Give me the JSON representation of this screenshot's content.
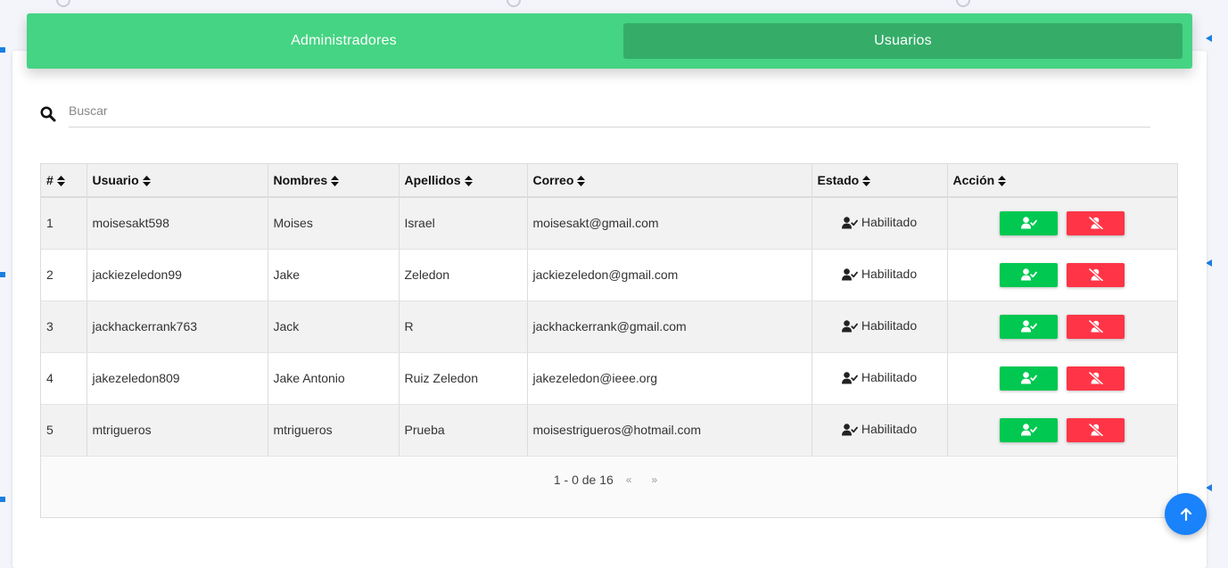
{
  "tabs": [
    {
      "label": "Administradores",
      "active": false
    },
    {
      "label": "Usuarios",
      "active": true
    }
  ],
  "search": {
    "placeholder": "Buscar"
  },
  "table": {
    "headers": [
      "#",
      "Usuario",
      "Nombres",
      "Apellidos",
      "Correo",
      "Estado",
      "Acción"
    ],
    "rows": [
      {
        "num": "1",
        "usuario": "moisesakt598",
        "nombres": "Moises",
        "apellidos": "Israel",
        "correo": "moisesakt@gmail.com",
        "estado": "Habilitado"
      },
      {
        "num": "2",
        "usuario": "jackiezeledon99",
        "nombres": "Jake",
        "apellidos": "Zeledon",
        "correo": "jackiezeledon@gmail.com",
        "estado": "Habilitado"
      },
      {
        "num": "3",
        "usuario": "jackhackerrank763",
        "nombres": "Jack",
        "apellidos": "R",
        "correo": "jackhackerrank@gmail.com",
        "estado": "Habilitado"
      },
      {
        "num": "4",
        "usuario": "jakezeledon809",
        "nombres": "Jake Antonio",
        "apellidos": "Ruiz Zeledon",
        "correo": "jakezeledon@ieee.org",
        "estado": "Habilitado"
      },
      {
        "num": "5",
        "usuario": "mtrigueros",
        "nombres": "mtrigueros",
        "apellidos": "Prueba",
        "correo": "moisestrigueros@hotmail.com",
        "estado": "Habilitado"
      }
    ]
  },
  "pagination": {
    "text": "1 - 0 de 16",
    "prev": "«",
    "next": "»"
  },
  "colors": {
    "accent": "#45d483",
    "tab_active": "#35ad69",
    "enable": "#00c851",
    "disable": "#ff3547",
    "fab": "#1a82fb"
  },
  "icons": {
    "search": "search-icon",
    "sort": "sort-icon",
    "status": "user-check-icon",
    "enable_button": "user-check-icon",
    "disable_button": "user-slash-icon",
    "fab": "arrow-up-icon"
  }
}
